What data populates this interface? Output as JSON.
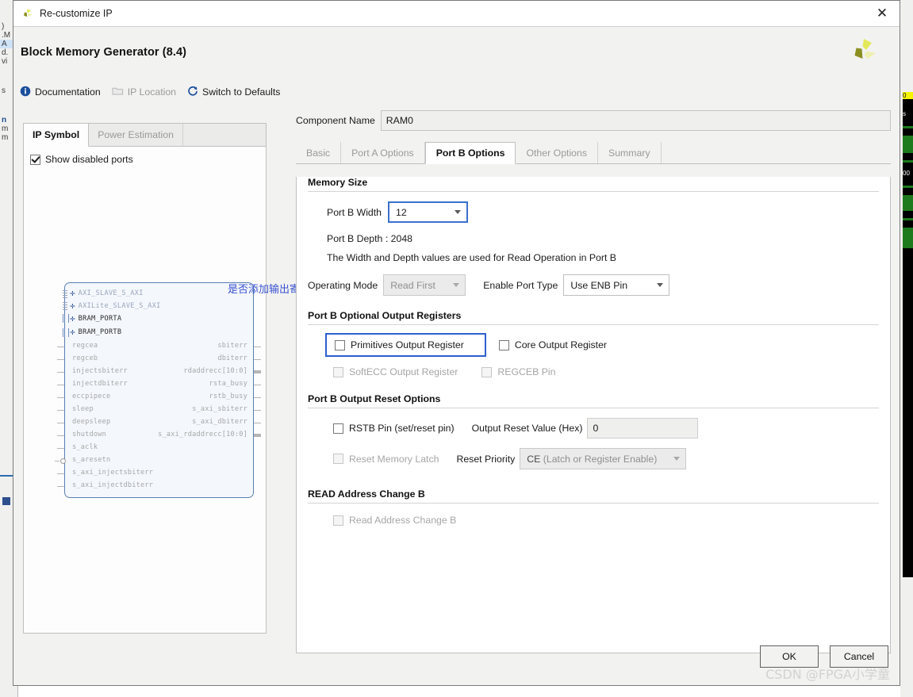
{
  "window": {
    "title": "Re-customize IP",
    "close_icon": "close-icon",
    "app_icon": "xilinx-logo-icon"
  },
  "header": {
    "title": "Block Memory Generator (8.4)",
    "logo_icon": "xilinx-logo-icon"
  },
  "linkbar": [
    {
      "label": "Documentation",
      "icon": "info-icon",
      "disabled": false
    },
    {
      "label": "IP Location",
      "icon": "folder-icon",
      "disabled": true
    },
    {
      "label": "Switch to Defaults",
      "icon": "refresh-icon",
      "disabled": false
    }
  ],
  "left_panel": {
    "tabs": [
      {
        "label": "IP Symbol",
        "active": true
      },
      {
        "label": "Power Estimation",
        "active": false
      }
    ],
    "show_disabled_ports": {
      "label": "Show disabled ports",
      "checked": true
    },
    "symbol": {
      "buses": [
        {
          "label": "AXI_SLAVE_S_AXI",
          "dim": true
        },
        {
          "label": "AXILite_SLAVE_S_AXI",
          "dim": true
        },
        {
          "label": "BRAM_PORTA",
          "dim": false
        },
        {
          "label": "BRAM_PORTB",
          "dim": false
        }
      ],
      "left_pins": [
        "regcea",
        "regceb",
        "injectsbiterr",
        "injectdbiterr",
        "eccpipece",
        "sleep",
        "deepsleep",
        "shutdown",
        "s_aclk",
        "s_aresetn",
        "s_axi_injectsbiterr",
        "s_axi_injectdbiterr"
      ],
      "right_pins": [
        "sbiterr",
        "dbiterr",
        "rdaddrecc[10:0]",
        "rsta_busy",
        "rstb_busy",
        "s_axi_sbiterr",
        "s_axi_dbiterr",
        "s_axi_rdaddrecc[10:0]"
      ],
      "annotation": "是否添加输出寄存器",
      "annotation_color": "#3a53d0"
    }
  },
  "right_panel": {
    "component_name_label": "Component Name",
    "component_name_value": "RAM0",
    "tabs": [
      {
        "label": "Basic",
        "active": false
      },
      {
        "label": "Port A Options",
        "active": false
      },
      {
        "label": "Port B Options",
        "active": true
      },
      {
        "label": "Other Options",
        "active": false
      },
      {
        "label": "Summary",
        "active": false
      }
    ],
    "memory_size": {
      "title": "Memory Size",
      "port_b_width_label": "Port B Width",
      "port_b_width_value": "12",
      "port_b_depth_text": "Port B Depth : 2048",
      "width_depth_note": "The Width and Depth values are used for Read Operation in Port B",
      "operating_mode_label": "Operating Mode",
      "operating_mode_value": "Read First",
      "enable_port_type_label": "Enable Port Type",
      "enable_port_type_value": "Use ENB Pin"
    },
    "optional_output_registers": {
      "title": "Port B Optional Output Registers",
      "primitives_output_register": {
        "label": "Primitives Output Register",
        "checked": false,
        "disabled": false
      },
      "core_output_register": {
        "label": "Core Output Register",
        "checked": false,
        "disabled": false
      },
      "softecc_output_register": {
        "label": "SoftECC Output Register",
        "checked": false,
        "disabled": true
      },
      "regceb_pin": {
        "label": "REGCEB Pin",
        "checked": false,
        "disabled": true
      }
    },
    "output_reset_options": {
      "title": "Port B Output Reset Options",
      "rstb_pin": {
        "label": "RSTB Pin (set/reset pin)",
        "checked": false,
        "disabled": false
      },
      "output_reset_value_label": "Output Reset Value (Hex)",
      "output_reset_value": "0",
      "reset_memory_latch": {
        "label": "Reset Memory Latch",
        "checked": false,
        "disabled": true
      },
      "reset_priority_label": "Reset Priority",
      "reset_priority_value_strong": "CE",
      "reset_priority_value_rest": " (Latch or Register Enable)"
    },
    "read_address_change": {
      "title": "READ Address Change B",
      "checkbox": {
        "label": "Read Address Change B",
        "checked": false,
        "disabled": true
      }
    }
  },
  "footer": {
    "ok_label": "OK",
    "cancel_label": "Cancel",
    "watermark": "CSDN @FPGA小学童"
  },
  "background": {
    "left_strip_rows": [
      ")",
      ".M",
      "A",
      "d.",
      "vi",
      "s",
      "n",
      "m",
      "m"
    ],
    "right_console_labels": [
      "0",
      "s",
      "00"
    ]
  }
}
